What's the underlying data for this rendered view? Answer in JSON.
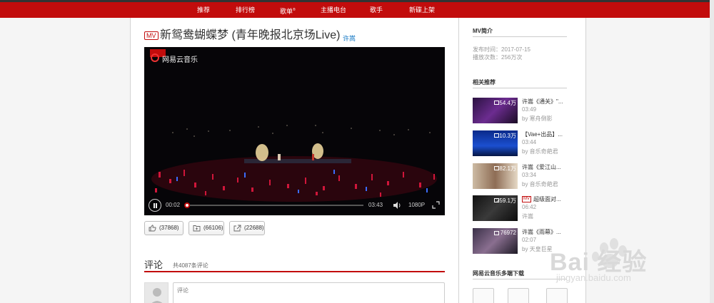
{
  "nav": {
    "items": [
      "推荐",
      "排行榜",
      "歌单",
      "主播电台",
      "歌手",
      "新碟上架"
    ],
    "badge": "®"
  },
  "mv": {
    "tag": "MV",
    "title": "新鸳鸯蝴蝶梦 (青年晚报北京场Live)",
    "artist": "许嵩"
  },
  "player": {
    "logo_text": "网易云音乐",
    "current_time": "00:02",
    "total_time": "03:43",
    "resolution": "1080P",
    "progress": 0.01
  },
  "actions": {
    "like": "(37868)",
    "collect": "(66106)",
    "share": "(22688)"
  },
  "comments": {
    "heading": "评论",
    "count": "共4087条评论",
    "placeholder": "评论"
  },
  "sidebar": {
    "intro_heading": "MV简介",
    "publish": "发布时间：2017-07-15",
    "plays": "播放次数：256万次",
    "related_heading": "相关推荐",
    "related": [
      {
        "count": "54.4万",
        "mv": "",
        "title": "许嵩《通关》\"...",
        "duration": "03:49",
        "by": "by 寒舟倒影"
      },
      {
        "count": "10.3万",
        "mv": "",
        "title": "【Vae+出品】...",
        "duration": "03:44",
        "by": "by 音乐奇葩君"
      },
      {
        "count": "82.1万",
        "mv": "",
        "title": "许嵩《爱江山...",
        "duration": "03:34",
        "by": "by 音乐奇葩君"
      },
      {
        "count": "259.1万",
        "mv": "MV",
        "title": "超级面对...",
        "duration": "06:42",
        "by": "许嵩"
      },
      {
        "count": "76972",
        "mv": "",
        "title": "许嵩《雨幕》...",
        "duration": "02:07",
        "by": "by 天皇巨星"
      }
    ],
    "download_heading": "网易云音乐多端下载"
  },
  "watermark": {
    "text": "Bai 经验",
    "url": "jingyan.baidu.com"
  },
  "colors": {
    "brand": "#c20c0c",
    "link": "#0c73c2"
  }
}
